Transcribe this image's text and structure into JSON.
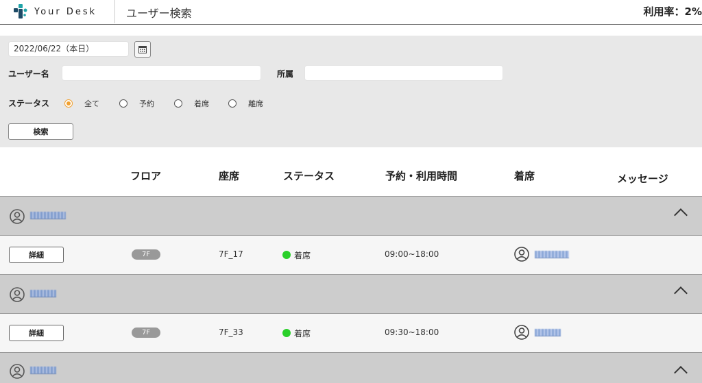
{
  "header": {
    "brand": "Your Desk",
    "title": "ユーザー検索",
    "usage": "利用率：2%"
  },
  "search": {
    "date_value": "2022/06/22（本日）",
    "username_label": "ユーザー名",
    "dept_label": "所属",
    "status_label": "ステータス",
    "status_options": [
      "全て",
      "予約",
      "着席",
      "離席"
    ],
    "selected_status": "全て",
    "search_button": "検索"
  },
  "table": {
    "headers": [
      "フロア",
      "座席",
      "ステータス",
      "予約・利用時間",
      "着席",
      "メッセージ"
    ],
    "groups": [
      {
        "detail_label": "詳細",
        "floor": "7F",
        "seat": "7F_17",
        "status": "着席",
        "time": "09:00~18:00"
      },
      {
        "detail_label": "詳細",
        "floor": "7F",
        "seat": "7F_33",
        "status": "着席",
        "time": "09:30~18:00"
      }
    ]
  },
  "colors": {
    "accent_orange": "#f0a030",
    "status_green": "#2ad02a",
    "logo_teal": "#1fa3a8",
    "logo_dark": "#1d4a66"
  }
}
